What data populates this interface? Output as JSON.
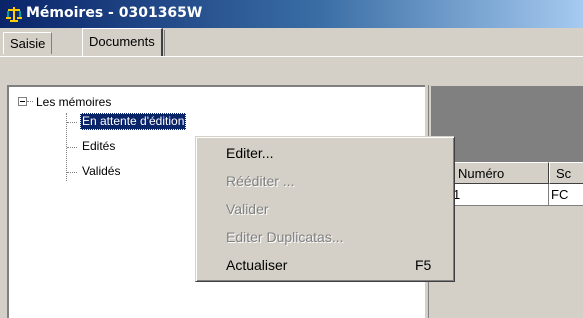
{
  "window": {
    "title": "Mémoires - 0301365W"
  },
  "tabs": [
    {
      "label": "Saisie",
      "active": false
    },
    {
      "label": "Documents",
      "active": true
    }
  ],
  "tree": {
    "root": "Les mémoires",
    "items": [
      "En attente d'édition",
      "Edités",
      "Validés"
    ],
    "selected": "En attente d'édition"
  },
  "grid": {
    "columns": [
      "Numéro",
      "Sc"
    ],
    "rows": [
      [
        "1",
        "FC"
      ]
    ]
  },
  "context_menu": {
    "items": [
      {
        "label": "Editer...",
        "enabled": true,
        "shortcut": ""
      },
      {
        "label": "Rééditer ...",
        "enabled": false,
        "shortcut": ""
      },
      {
        "label": "Valider",
        "enabled": false,
        "shortcut": ""
      },
      {
        "label": "Editer Duplicatas...",
        "enabled": false,
        "shortcut": ""
      },
      {
        "label": "Actualiser",
        "enabled": true,
        "shortcut": "F5"
      }
    ]
  },
  "colors": {
    "title_gradient_start": "#0a246a",
    "title_gradient_end": "#a6caf0",
    "selection": "#0a246a",
    "face": "#d4d0c8"
  }
}
